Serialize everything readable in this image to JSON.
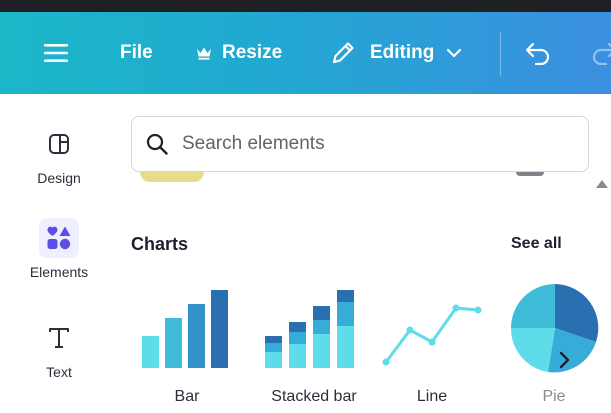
{
  "toolbar": {
    "file_label": "File",
    "resize_label": "Resize",
    "editing_label": "Editing"
  },
  "sidebar": {
    "items": [
      {
        "label": "Design"
      },
      {
        "label": "Elements"
      },
      {
        "label": "Text"
      }
    ]
  },
  "search": {
    "placeholder": "Search elements"
  },
  "charts": {
    "section_title": "Charts",
    "see_all_label": "See all",
    "items": [
      {
        "label": "Bar"
      },
      {
        "label": "Stacked bar"
      },
      {
        "label": "Line"
      },
      {
        "label": "Pie"
      }
    ]
  },
  "colors": {
    "toolbar_start": "#1bb7c7",
    "toolbar_end": "#3b8fe0",
    "chart_light": "#5fdcea",
    "chart_mid": "#38acd8",
    "chart_dark": "#2a6fb0"
  },
  "icons": [
    "menu-icon",
    "crown-icon",
    "pencil-icon",
    "chevron-down-icon",
    "undo-icon",
    "redo-icon",
    "design-layout-icon",
    "elements-shapes-icon",
    "text-t-icon",
    "search-icon",
    "chevron-right-icon"
  ]
}
